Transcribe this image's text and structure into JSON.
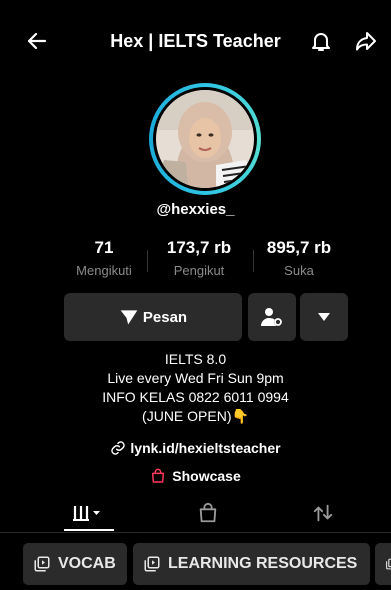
{
  "header": {
    "title": "Hex | IELTS Teacher"
  },
  "profile": {
    "handle": "@hexxies_",
    "stats": [
      {
        "value": "71",
        "label": "Mengikuti"
      },
      {
        "value": "173,7 rb",
        "label": "Pengikut"
      },
      {
        "value": "895,7 rb",
        "label": "Suka"
      }
    ],
    "message_button": "Pesan",
    "bio": [
      "IELTS 8.0",
      "Live every Wed Fri Sun 9pm",
      "INFO KELAS 0822 6011 0994",
      "(JUNE OPEN)👇"
    ],
    "link": "lynk.id/hexieltsteacher",
    "showcase": "Showcase"
  },
  "chips": [
    "VOCAB",
    "LEARNING RESOURCES"
  ],
  "colors": {
    "background": "#000000",
    "button": "#2b2b2b",
    "ring": "#2ec4e5",
    "showcase_icon": "#ff3b5c"
  }
}
